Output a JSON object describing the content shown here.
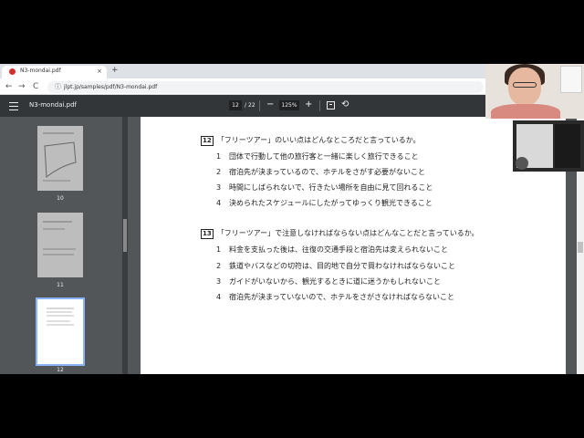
{
  "browser": {
    "tab_title": "N3-mondai.pdf",
    "tab_close": "×",
    "new_tab": "+",
    "back": "←",
    "forward": "→",
    "reload": "C",
    "lock": "ⓘ",
    "url": "jlpt.jp/samples/pdf/N3-mondai.pdf"
  },
  "pdf_toolbar": {
    "title": "N3-mondai.pdf",
    "current_page": "12",
    "page_separator": "/",
    "total_pages": "22",
    "zoom_out": "−",
    "zoom": "125%",
    "zoom_in": "+",
    "rotate": "⟲"
  },
  "thumbnails": [
    {
      "number": "10"
    },
    {
      "number": "11"
    },
    {
      "number": "12",
      "selected": true
    }
  ],
  "questions": [
    {
      "number": "12",
      "prompt": "「フリーツアー」のいい点はどんなところだと言っているか。",
      "options": [
        {
          "n": "1",
          "text": "団体で行動して他の旅行客と一緒に楽しく旅行できること"
        },
        {
          "n": "2",
          "text": "宿泊先が決まっているので、ホテルをさがす必要がないこと"
        },
        {
          "n": "3",
          "text": "時間にしばられないで、行きたい場所を自由に見て回れること"
        },
        {
          "n": "4",
          "text": "決められたスケジュールにしたがってゆっくり観光できること"
        }
      ]
    },
    {
      "number": "13",
      "prompt": "「フリーツアー」で注意しなければならない点はどんなことだと言っているか。",
      "options": [
        {
          "n": "1",
          "text": "料金を支払った後は、往復の交通手段と宿泊先は変えられないこと"
        },
        {
          "n": "2",
          "text": "鉄道やバスなどの切符は、目的地で自分で買わなければならないこと"
        },
        {
          "n": "3",
          "text": "ガイドがいないから、観光するときに道に迷うかもしれないこと"
        },
        {
          "n": "4",
          "text": "宿泊先が決まっていないので、ホテルをさがさなければならないこと"
        }
      ]
    }
  ],
  "colors": {
    "toolbar": "#323639",
    "viewer_bg": "#525659",
    "thumb_selected_border": "#8ab4f8"
  }
}
